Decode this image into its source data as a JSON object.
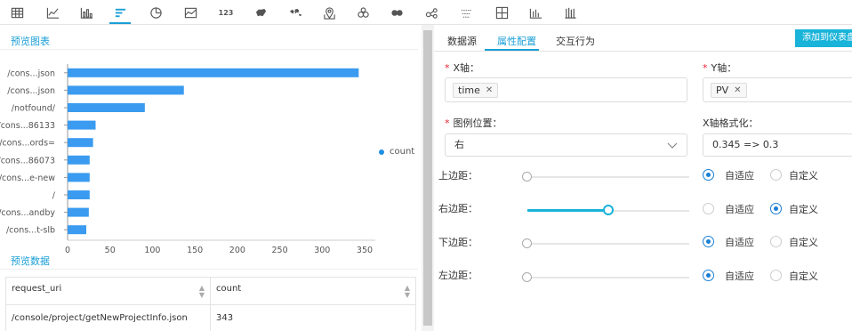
{
  "toolbar": {
    "icons": [
      "table-icon",
      "line-chart-icon",
      "bar-chart-icon",
      "horizontal-bar-chart-icon",
      "pie-chart-icon",
      "area-chart-icon",
      "number-card-icon",
      "china-map-icon",
      "world-map-icon",
      "pin-map-icon",
      "bubble-icon",
      "scatter-icon",
      "network-icon",
      "radar-icon",
      "layout-icon",
      "column-icon",
      "barcode-icon"
    ],
    "number_icon_text": "123",
    "active": "horizontal-bar-chart-icon"
  },
  "preview_chart": {
    "title": "预览图表"
  },
  "chart_data": {
    "type": "bar",
    "orientation": "horizontal",
    "categories": [
      "/cons...json",
      "/cons...json",
      "/notfound/",
      "/cons...86133",
      "/cons...ords=",
      "/cons...86073",
      "/cons...e-new",
      "/",
      "/cons...andby",
      "/cons...t-slb"
    ],
    "series": [
      {
        "name": "count",
        "values": [
          343,
          137,
          91,
          33,
          30,
          26,
          26,
          26,
          25,
          22
        ],
        "color": "#3a9bf0"
      }
    ],
    "xlim": [
      0,
      350
    ],
    "xticks": [
      "0",
      "50",
      "100",
      "150",
      "200",
      "250",
      "300",
      "350"
    ],
    "legend_position": "right"
  },
  "preview_data": {
    "title": "预览数据",
    "columns": [
      "request_uri",
      "count"
    ],
    "rows": [
      [
        "/console/project/getNewProjectInfo.json",
        "343"
      ]
    ]
  },
  "right_tabs": {
    "tabs": [
      "数据源",
      "属性配置",
      "交互行为"
    ],
    "active": "属性配置",
    "add_button": "添加到仪表盘"
  },
  "form": {
    "x_axis_label": "X轴：",
    "x_axis_tag": "time",
    "y_axis_label": "Y轴：",
    "y_axis_tag": "PV",
    "legend_pos_label": "图例位置：",
    "legend_pos_value": "右",
    "x_format_label": "X轴格式化：",
    "x_format_value": "0.345 => 0.3",
    "auto_label": "自适应",
    "custom_label": "自定义",
    "margins": [
      {
        "label": "上边距：",
        "value": 0,
        "mode": "auto"
      },
      {
        "label": "右边距：",
        "value": 1,
        "mode": "custom"
      },
      {
        "label": "下边距：",
        "value": 0,
        "mode": "auto"
      },
      {
        "label": "左边距：",
        "value": 0,
        "mode": "auto"
      }
    ]
  },
  "colors": {
    "accent": "#1a9fd6",
    "bar": "#3a9bf0",
    "button": "#1ab3d9"
  }
}
